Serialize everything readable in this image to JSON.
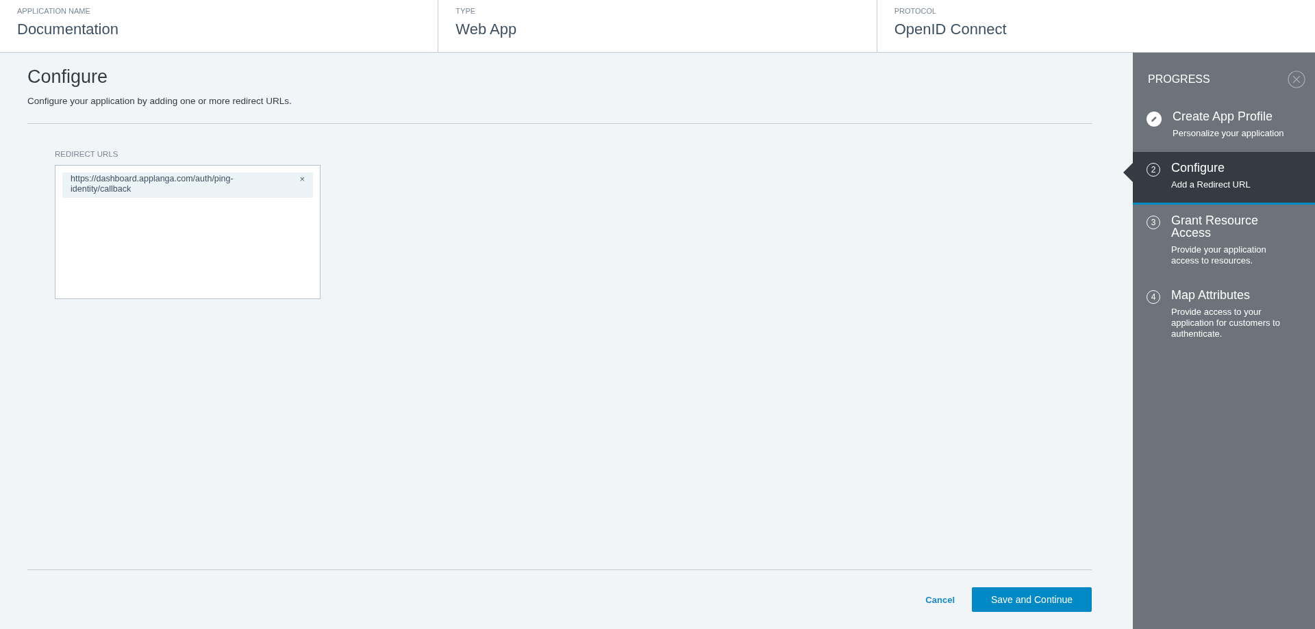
{
  "header": [
    {
      "label": "APPLICATION NAME",
      "value": "Documentation"
    },
    {
      "label": "TYPE",
      "value": "Web App"
    },
    {
      "label": "PROTOCOL",
      "value": "OpenID Connect"
    }
  ],
  "main": {
    "title": "Configure",
    "description": "Configure your application by adding one or more redirect URLs.",
    "redirect_urls": {
      "label": "REDIRECT URLS",
      "items": [
        {
          "url": "https://dashboard.applanga.com/auth/ping-identity/callback",
          "remove": "×"
        }
      ]
    },
    "buttons": {
      "cancel": "Cancel",
      "submit": "Save and Continue"
    }
  },
  "progress": {
    "title": "PROGRESS",
    "steps": [
      {
        "kind": "done",
        "title": "Create App Profile",
        "subtitle": "Personalize your application",
        "selected": false
      },
      {
        "kind": "number",
        "number": "2",
        "title": "Configure",
        "subtitle": "Add a Redirect URL",
        "selected": true
      },
      {
        "kind": "number",
        "number": "3",
        "title": "Grant Resource Access",
        "subtitle": "Provide your application access to resources.",
        "selected": false
      },
      {
        "kind": "number",
        "number": "4",
        "title": "Map Attributes",
        "subtitle": "Provide access to your application for customers to authenticate.",
        "selected": false
      }
    ]
  }
}
